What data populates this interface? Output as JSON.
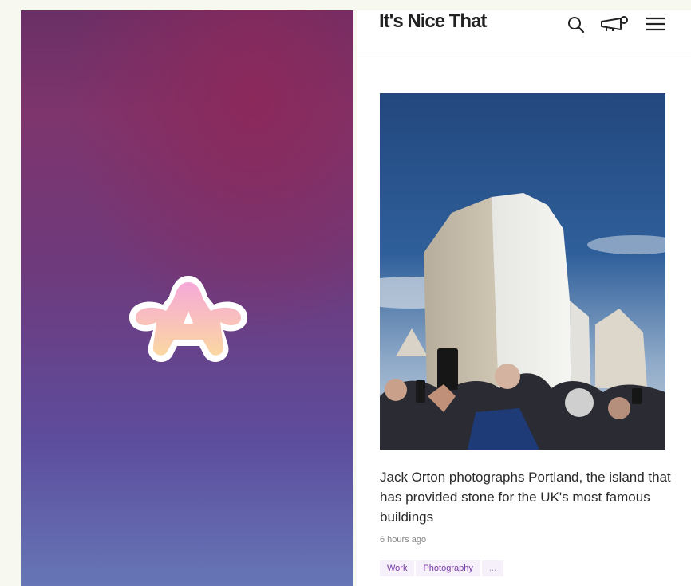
{
  "left_panel": {
    "logo_icon": "app-a-logo-icon"
  },
  "site": {
    "brand": "It's Nice That",
    "icons": [
      "search-icon",
      "megaphone-icon",
      "menu-icon"
    ]
  },
  "article": {
    "image_icon": "hero-photo",
    "headline": "Jack Orton photographs Portland, the island that has provided stone for the UK's most famous buildings",
    "timestamp": "6 hours ago",
    "tags": [
      "Work",
      "Photography",
      "..."
    ]
  }
}
